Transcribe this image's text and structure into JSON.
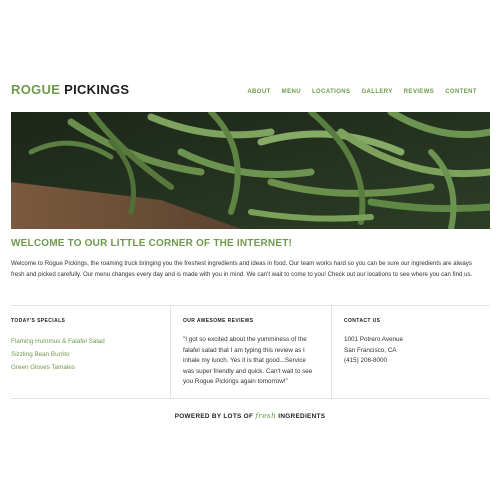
{
  "brand": {
    "name_part1": "ROGUE",
    "name_part2": "PICKINGS"
  },
  "nav": [
    {
      "label": "ABOUT"
    },
    {
      "label": "MENU"
    },
    {
      "label": "LOCATIONS"
    },
    {
      "label": "GALLERY"
    },
    {
      "label": "REVIEWS"
    },
    {
      "label": "CONTENT"
    }
  ],
  "hero": {
    "icon": "green-beans-photo"
  },
  "welcome": {
    "title": "WELCOME TO OUR LITTLE CORNER OF THE INTERNET!",
    "text": "Welcome to Rogue Pickings, the roaming truck bringing you the freshest ingredients and ideas in food. Our team works hard so you can be sure our ingredients are always fresh and picked carefully. Our menu changes every day and is made with you in mind. We can't wait to come to you! Check out our locations to see where you can find us."
  },
  "specials": {
    "title": "TODAY'S SPECIALS",
    "items": [
      "Flaming Hummus & Falafel Salad",
      "Sizzling Bean Burrito",
      "Green Gloves Tamales"
    ]
  },
  "reviews": {
    "title": "OUR AWESOME REVIEWS",
    "text": "\"I got so excited about the yumminess of the falafel salad that I am typing this review as I inhale my lunch. Yes it is that good...Service was super friendly and quick. Can't wait to see you Rogue Pickings again tomorrow!\""
  },
  "contact": {
    "title": "CONTACT US",
    "address1": "1001 Potrero Avenue",
    "address2": "San Francisco, CA",
    "phone": "(415) 206-8000"
  },
  "footer": {
    "prefix": "POWERED BY LOTS OF",
    "fresh": "fresh",
    "suffix": "INGREDIENTS"
  },
  "colors": {
    "accent": "#6f9a4d",
    "text": "#333333",
    "divider": "#e3e3e3"
  }
}
